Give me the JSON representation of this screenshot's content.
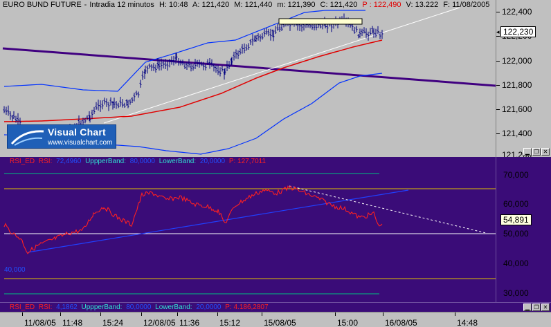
{
  "price_panel": {
    "instrument": "EURO BUND FUTURE",
    "interval": "Intradia 12 minutos",
    "ohlc": [
      {
        "label": "H: 10:48",
        "color": "#000000"
      },
      {
        "label": "A: 121,420",
        "color": "#000000"
      },
      {
        "label": "M: 121,440",
        "color": "#000000"
      },
      {
        "label": "m: 121,390",
        "color": "#000000"
      },
      {
        "label": "C: 121,420",
        "color": "#000000"
      },
      {
        "label": "P : 122,490",
        "color": "#e00000"
      },
      {
        "label": "V: 13.222",
        "color": "#000000"
      },
      {
        "label": "F: 11/08/2005",
        "color": "#000000"
      }
    ],
    "axis_labels": [
      "122,400",
      "122,200",
      "122,000",
      "121,800",
      "121,600",
      "121,400",
      "121,200"
    ],
    "current_price": "122,230",
    "logo": {
      "title": "Visual Chart",
      "url": "www.visualchart.com"
    },
    "colors": {
      "bars": "#000080",
      "ma": "#e00000",
      "bands": "#0030ff",
      "trend_purple": "#400080",
      "trend_white": "#ffffff"
    }
  },
  "rsi_panel": {
    "header": [
      {
        "text": "RSI_ED",
        "color": "#ff2020"
      },
      {
        "text": "RSI:",
        "color": "#ff2020"
      },
      {
        "text": "72,4960",
        "color": "#2050ff"
      },
      {
        "text": "UppperBand:",
        "color": "#30e0d0"
      },
      {
        "text": "80,0000",
        "color": "#2050ff"
      },
      {
        "text": "LowerBand:",
        "color": "#30e0d0"
      },
      {
        "text": "20,0000",
        "color": "#2050ff"
      },
      {
        "text": "P: 127,7011",
        "color": "#ff2020"
      }
    ],
    "axis_labels": [
      "70,000",
      "60,000",
      "50,000",
      "40,000",
      "30,000"
    ],
    "current_value": "54,891",
    "side_note": "40,000",
    "colors": {
      "rsi": "#ff2020",
      "upper": "#e0c000",
      "lower": "#e0c000",
      "outer": "#00c080",
      "mid": "#ffffff",
      "trend": "#2040ff"
    }
  },
  "sub_panel": {
    "header": [
      {
        "text": "RSI_ED",
        "color": "#ff2020"
      },
      {
        "text": "RSI:",
        "color": "#ff2020"
      },
      {
        "text": "4,1862",
        "color": "#2050ff"
      },
      {
        "text": "UppperBand:",
        "color": "#30e0d0"
      },
      {
        "text": "80,0000",
        "color": "#2050ff"
      },
      {
        "text": "LowerBand:",
        "color": "#30e0d0"
      },
      {
        "text": "20,0000",
        "color": "#2050ff"
      },
      {
        "text": "P: 4.186,2807",
        "color": "#ff2020"
      }
    ]
  },
  "time_axis": {
    "labels": [
      "11/08/05",
      "11:48",
      "15:24",
      "12/08/05",
      "11:36",
      "15:12",
      "15/08/05",
      "15:00",
      "16/08/05",
      "14:48"
    ]
  }
}
